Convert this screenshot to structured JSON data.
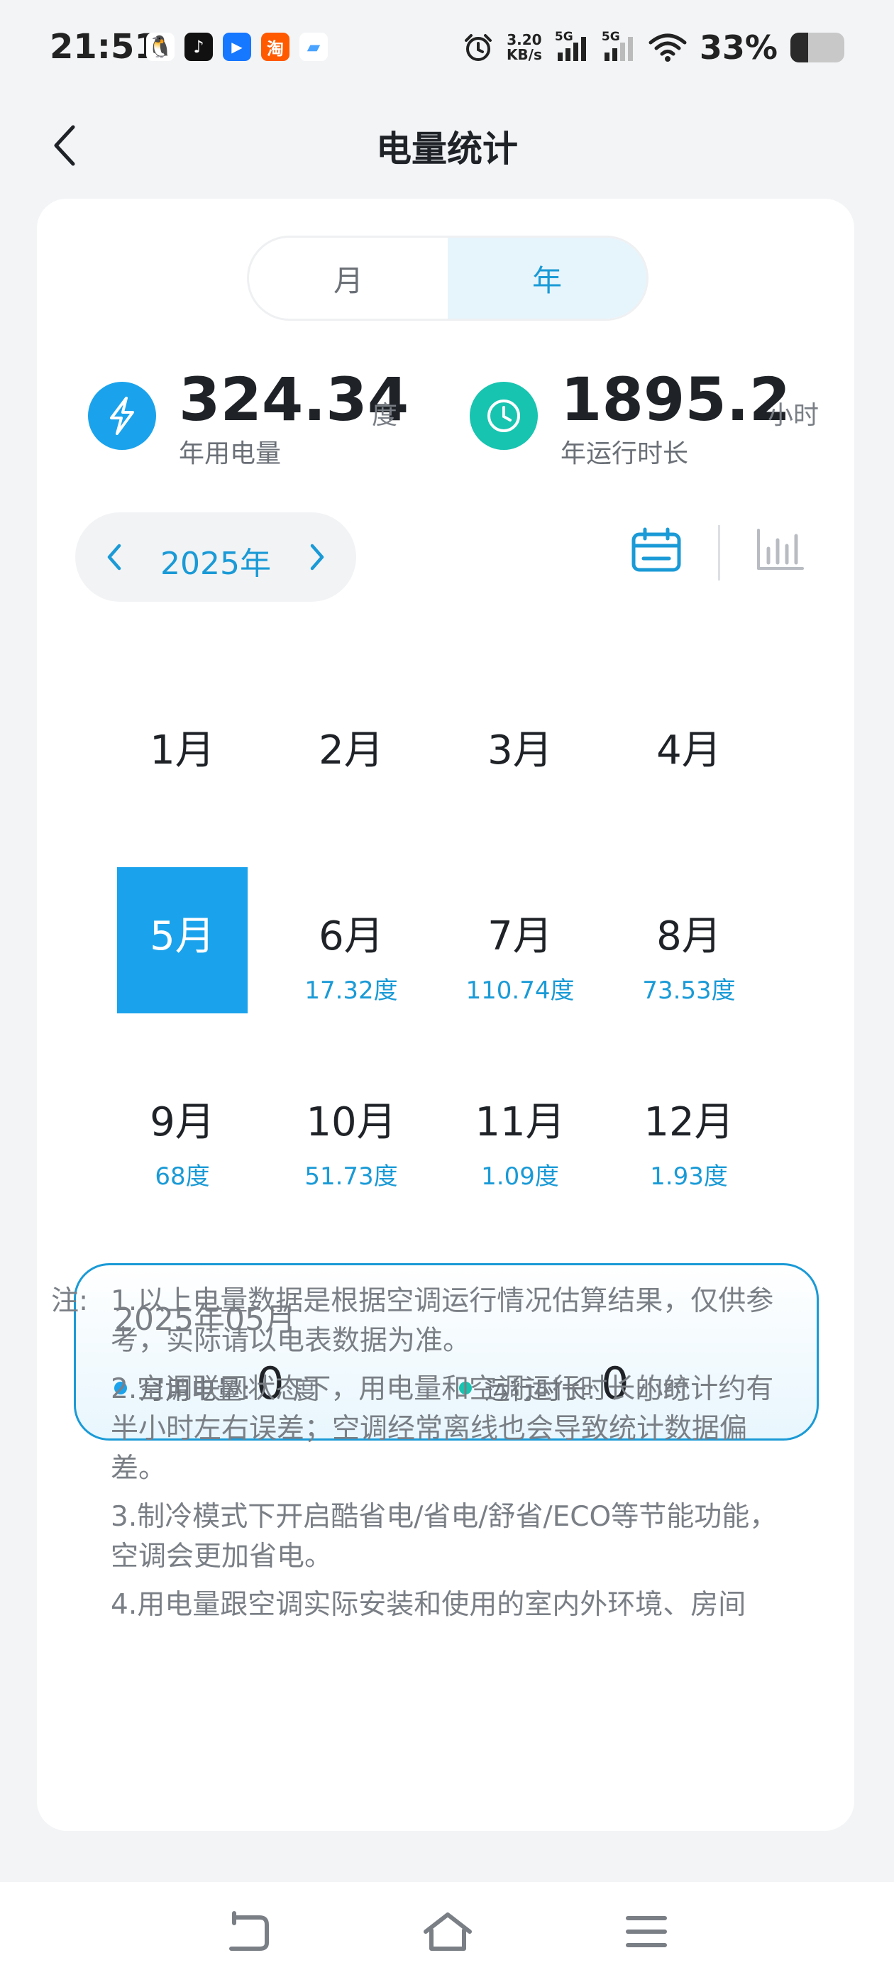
{
  "status_bar": {
    "time": "21:51",
    "apps": [
      {
        "icon": "qq-icon",
        "glyph": "🐧",
        "color": "#ffffff"
      },
      {
        "icon": "tiktok-icon",
        "glyph": "♪",
        "color": "#111111"
      },
      {
        "icon": "alipay-icon",
        "glyph": "▶",
        "color": "#1677ff"
      },
      {
        "icon": "taobao-icon",
        "glyph": "淘",
        "color": "#ff5a00"
      },
      {
        "icon": "message-icon",
        "glyph": "▰",
        "color": "#4aa3ff"
      }
    ],
    "net_speed_value": "3.20",
    "net_speed_unit": "KB/s",
    "signal_label_1": "5G",
    "signal_label_2": "5G",
    "battery_percent": "33%",
    "battery_level": 0.33
  },
  "header": {
    "title": "电量统计",
    "back_icon": "chevron-left-icon"
  },
  "tabs": {
    "month": "月",
    "year": "年",
    "active": "year"
  },
  "stats": {
    "energy": {
      "value": "324.34",
      "unit": "度",
      "label": "年用电量",
      "icon": "lightning-icon",
      "color": "#1aa3ec"
    },
    "runtime": {
      "value": "1895.2",
      "unit": "小时",
      "label": "年运行时长",
      "icon": "clock-icon",
      "color": "#17c4b0"
    }
  },
  "year_selector": {
    "label": "2025年",
    "prev_icon": "chevron-left-icon",
    "next_icon": "chevron-right-icon"
  },
  "view_toggle": {
    "calendar_icon": "calendar-icon",
    "bar_icon": "bar-chart-icon",
    "active_color": "#1a9ad6",
    "inactive_color": "#b8bcc2"
  },
  "months": [
    {
      "name": "1月",
      "value": ""
    },
    {
      "name": "2月",
      "value": ""
    },
    {
      "name": "3月",
      "value": ""
    },
    {
      "name": "4月",
      "value": ""
    },
    {
      "name": "5月",
      "value": "",
      "selected": true
    },
    {
      "name": "6月",
      "value": "17.32度"
    },
    {
      "name": "7月",
      "value": "110.74度"
    },
    {
      "name": "8月",
      "value": "73.53度"
    },
    {
      "name": "9月",
      "value": "68度"
    },
    {
      "name": "10月",
      "value": "51.73度"
    },
    {
      "name": "11月",
      "value": "1.09度"
    },
    {
      "name": "12月",
      "value": "1.93度"
    }
  ],
  "detail": {
    "period": "2025年05月",
    "energy_label": "月用电量:",
    "energy_value": "0",
    "energy_unit": "度",
    "energy_dot_color": "#1aa3ec",
    "runtime_label": "运行时长:",
    "runtime_value": "0",
    "runtime_unit": "小时",
    "runtime_dot_color": "#17c4b0"
  },
  "notes": {
    "prefix": "注:",
    "items": [
      "1.以上电量数据是根据空调运行情况估算结果，仅供参考，实际请以电表数据为准。",
      "2.空调联网状态下，用电量和空调运行时长的统计约有半小时左右误差；空调经常离线也会导致统计数据偏差。",
      "3.制冷模式下开启酷省电/省电/舒省/ECO等节能功能，空调会更加省电。",
      "4.用电量跟空调实际安装和使用的室内外环境、房间"
    ]
  },
  "bottom_nav": {
    "back_icon": "return-icon",
    "home_icon": "home-icon",
    "menu_icon": "menu-icon"
  }
}
